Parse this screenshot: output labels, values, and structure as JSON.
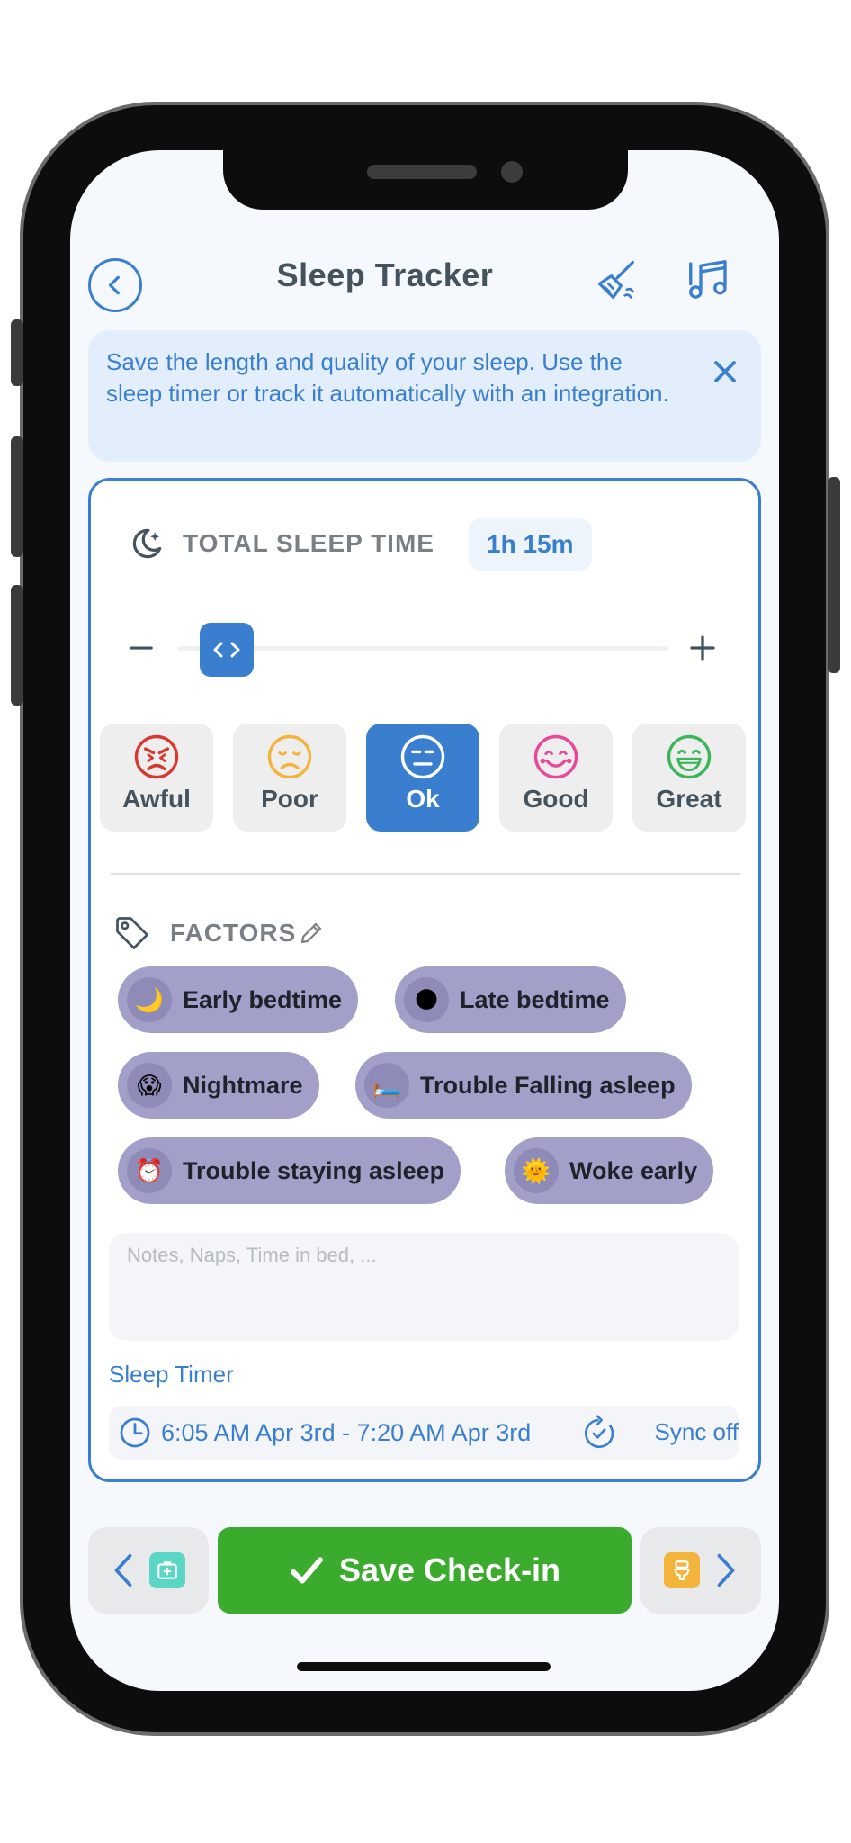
{
  "header": {
    "title": "Sleep Tracker"
  },
  "banner": {
    "text": "Save the length and quality of your sleep. Use the sleep timer or track it automatically with an integration."
  },
  "total_sleep": {
    "label": "TOTAL SLEEP TIME",
    "value": "1h 15m",
    "slider_fraction": 0.1
  },
  "moods": [
    {
      "label": "Awful",
      "color": "#d9382f",
      "icon": "angry-face-icon"
    },
    {
      "label": "Poor",
      "color": "#f3b43c",
      "icon": "sad-face-icon"
    },
    {
      "label": "Ok",
      "color": "#ffffff",
      "icon": "neutral-face-icon",
      "selected": true
    },
    {
      "label": "Good",
      "color": "#e8489a",
      "icon": "smile-face-icon"
    },
    {
      "label": "Great",
      "color": "#3db65a",
      "icon": "grin-face-icon"
    }
  ],
  "factors": {
    "label": "FACTORS",
    "chips": [
      {
        "emoji": "🌙",
        "label": "Early bedtime"
      },
      {
        "emoji": "🌑",
        "label": "Late bedtime"
      },
      {
        "emoji": "😱",
        "label": "Nightmare"
      },
      {
        "emoji": "🛏️",
        "label": "Trouble Falling asleep"
      },
      {
        "emoji": "⏰",
        "label": "Trouble staying asleep"
      },
      {
        "emoji": "🌞",
        "label": "Woke early"
      }
    ]
  },
  "notes": {
    "placeholder": "Notes, Naps, Time in bed, ..."
  },
  "timer": {
    "label": "Sleep Timer",
    "range": "6:05 AM Apr 3rd  - 7:20 AM Apr 3rd",
    "sync": "Sync off"
  },
  "footer": {
    "save_label": "Save Check-in"
  },
  "colors": {
    "accent": "#3a7fcf",
    "save": "#3aab2c",
    "chip": "#a29fc9"
  }
}
